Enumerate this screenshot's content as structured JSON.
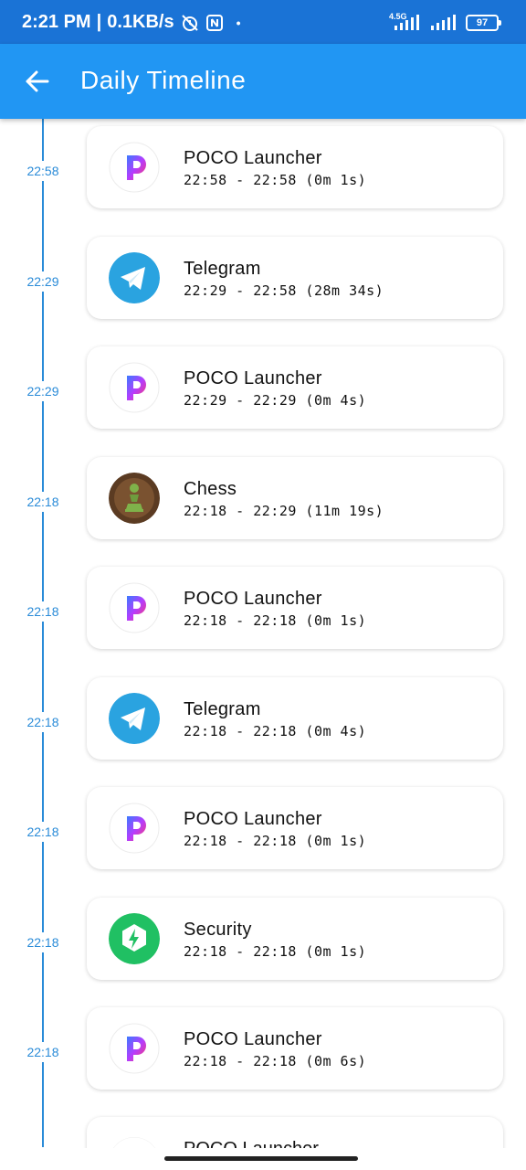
{
  "status_bar": {
    "time": "2:21 PM",
    "speed": "0.1KB/s",
    "network": "4.5G",
    "battery": "97"
  },
  "app_bar": {
    "title": "Daily Timeline",
    "back_icon": "arrow-left-icon"
  },
  "timeline": [
    {
      "time": "22:58",
      "app": "POCO Launcher",
      "range": "22:58 - 22:58 (0m 1s)",
      "icon": "poco"
    },
    {
      "time": "22:29",
      "app": "Telegram",
      "range": "22:29 - 22:58 (28m 34s)",
      "icon": "telegram"
    },
    {
      "time": "22:29",
      "app": "POCO Launcher",
      "range": "22:29 - 22:29 (0m 4s)",
      "icon": "poco"
    },
    {
      "time": "22:18",
      "app": "Chess",
      "range": "22:18 - 22:29 (11m 19s)",
      "icon": "chess"
    },
    {
      "time": "22:18",
      "app": "POCO Launcher",
      "range": "22:18 - 22:18 (0m 1s)",
      "icon": "poco"
    },
    {
      "time": "22:18",
      "app": "Telegram",
      "range": "22:18 - 22:18 (0m 4s)",
      "icon": "telegram"
    },
    {
      "time": "22:18",
      "app": "POCO Launcher",
      "range": "22:18 - 22:18 (0m 1s)",
      "icon": "poco"
    },
    {
      "time": "22:18",
      "app": "Security",
      "range": "22:18 - 22:18 (0m 1s)",
      "icon": "security"
    },
    {
      "time": "22:18",
      "app": "POCO Launcher",
      "range": "22:18 - 22:18 (0m 6s)",
      "icon": "poco"
    }
  ],
  "partial_entry": {
    "app": "POCO Launcher"
  },
  "colors": {
    "status_bar": "#1a73d6",
    "app_bar": "#2196f3",
    "timeline": "#2a8bd8",
    "telegram": "#2aa3e0",
    "security": "#20c063"
  }
}
